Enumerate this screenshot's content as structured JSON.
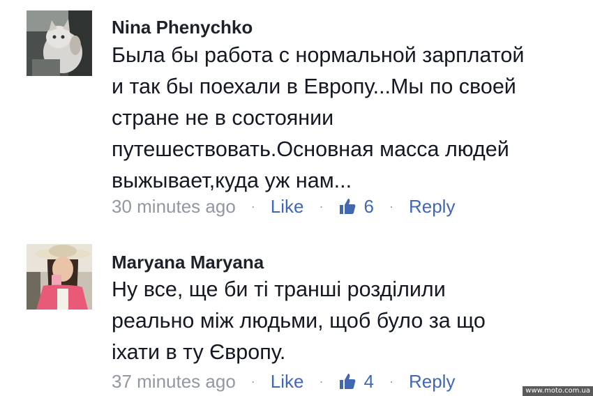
{
  "comments": [
    {
      "author": "Nina Phenychko",
      "text": "Была бы работа с нормальной зарплатой\nи так бы поехали в Европу...Мы по своей\nстране не в состоянии\nпутешествовать.Основная масса людей\nвыжывает,куда уж нам...",
      "time": "30 minutes ago",
      "like_label": "Like",
      "like_count": "6",
      "reply_label": "Reply",
      "avatar_icon": "cat-photo-avatar"
    },
    {
      "author": "Maryana Maryana",
      "text": "Ну все, ще би ті транші розділили\nреально між людьми, щоб було за що\nіхати в ту Європу.",
      "time": "37 minutes ago",
      "like_label": "Like",
      "like_count": "4",
      "reply_label": "Reply",
      "avatar_icon": "woman-selfie-avatar"
    }
  ],
  "separator": "·",
  "watermark": "www.moto.com.ua",
  "colors": {
    "link": "#4267b2",
    "meta": "#9197a3",
    "text": "#141823"
  }
}
